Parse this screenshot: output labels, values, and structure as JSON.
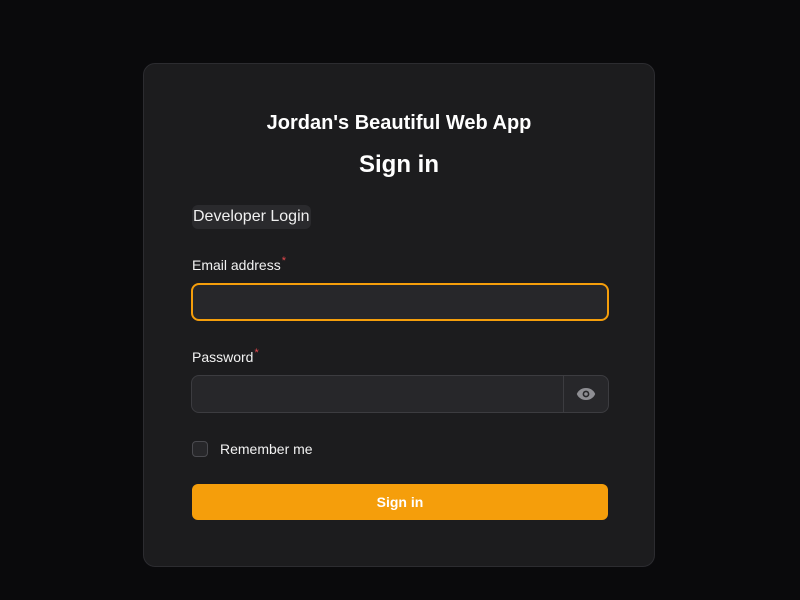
{
  "app": {
    "title": "Jordan's Beautiful Web App"
  },
  "form": {
    "heading": "Sign in",
    "developer_login_label": "Developer Login",
    "email": {
      "label": "Email address",
      "required_marker": "*",
      "value": "",
      "placeholder": ""
    },
    "password": {
      "label": "Password",
      "required_marker": "*",
      "value": "",
      "placeholder": "",
      "toggle_icon": "eye-icon"
    },
    "remember": {
      "label": "Remember me",
      "checked": false
    },
    "submit_label": "Sign in"
  },
  "colors": {
    "background": "#0a0a0c",
    "card": "#1c1c1e",
    "accent": "#f59e0b",
    "input_bg": "#27272a",
    "required": "#e5484d"
  }
}
